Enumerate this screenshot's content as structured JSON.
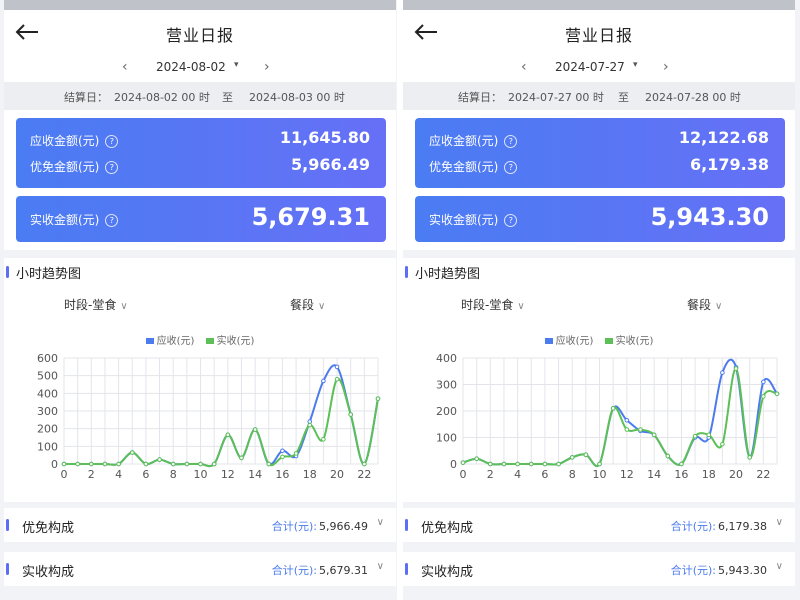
{
  "panels": [
    {
      "title": "营业日报",
      "date": "2024-08-02",
      "settle_label": "结算日：",
      "settle_start": "2024-08-02 00 时",
      "settle_to": "至",
      "settle_end": "2024-08-03 00 时",
      "receivable_label": "应收金额(元)",
      "receivable_value": "11,645.80",
      "discount_label": "优免金额(元)",
      "discount_value": "5,966.49",
      "received_label": "实收金额(元)",
      "received_value": "5,679.31",
      "trend_title": "小时趋势图",
      "filter_period": "时段-堂食",
      "filter_meal": "餐段",
      "discount_section": "优免构成",
      "discount_total_caption": "合计(元):",
      "discount_total_value": "5,966.49",
      "received_section": "实收构成",
      "received_total_caption": "合计(元):",
      "received_total_value": "5,679.31"
    },
    {
      "title": "营业日报",
      "date": "2024-07-27",
      "settle_label": "结算日：",
      "settle_start": "2024-07-27 00 时",
      "settle_to": "至",
      "settle_end": "2024-07-28 00 时",
      "receivable_label": "应收金额(元)",
      "receivable_value": "12,122.68",
      "discount_label": "优免金额(元)",
      "discount_value": "6,179.38",
      "received_label": "实收金额(元)",
      "received_value": "5,943.30",
      "trend_title": "小时趋势图",
      "filter_period": "时段-堂食",
      "filter_meal": "餐段",
      "discount_section": "优免构成",
      "discount_total_caption": "合计(元):",
      "discount_total_value": "6,179.38",
      "received_section": "实收构成",
      "received_total_caption": "合计(元):",
      "received_total_value": "5,943.30"
    }
  ],
  "colors": {
    "receivable": "#4b7bec",
    "received": "#5cbf57",
    "card_start": "#4a7cf3",
    "card_end": "#6670f6"
  },
  "icons": {
    "back": "arrow-left-icon",
    "prev": "chevron-left-icon",
    "next": "chevron-right-icon",
    "help": "question-circle-icon"
  },
  "chart_data": [
    {
      "type": "line",
      "legend": [
        "应收(元)",
        "实收(元)"
      ],
      "x": [
        0,
        1,
        2,
        3,
        4,
        5,
        6,
        7,
        8,
        9,
        10,
        11,
        12,
        13,
        14,
        15,
        16,
        17,
        18,
        19,
        20,
        21,
        22,
        23
      ],
      "xticks": [
        0,
        2,
        4,
        6,
        8,
        10,
        12,
        14,
        16,
        18,
        20,
        22
      ],
      "ylim": [
        0,
        600
      ],
      "yticks": [
        0,
        100,
        200,
        300,
        400,
        500,
        600
      ],
      "grid": true,
      "series": [
        {
          "name": "应收(元)",
          "values": [
            0,
            0,
            0,
            0,
            0,
            65,
            0,
            25,
            0,
            0,
            0,
            0,
            165,
            35,
            195,
            0,
            75,
            45,
            240,
            470,
            550,
            280,
            0,
            370
          ]
        },
        {
          "name": "实收(元)",
          "values": [
            0,
            0,
            0,
            0,
            0,
            65,
            0,
            25,
            0,
            0,
            0,
            0,
            165,
            35,
            195,
            0,
            40,
            60,
            220,
            140,
            480,
            280,
            0,
            370
          ]
        }
      ]
    },
    {
      "type": "line",
      "legend": [
        "应收(元)",
        "实收(元)"
      ],
      "x": [
        0,
        1,
        2,
        3,
        4,
        5,
        6,
        7,
        8,
        9,
        10,
        11,
        12,
        13,
        14,
        15,
        16,
        17,
        18,
        19,
        20,
        21,
        22,
        23
      ],
      "xticks": [
        0,
        2,
        4,
        6,
        8,
        10,
        12,
        14,
        16,
        18,
        20,
        22
      ],
      "ylim": [
        0,
        400
      ],
      "yticks": [
        0,
        100,
        200,
        300,
        400
      ],
      "grid": true,
      "series": [
        {
          "name": "应收(元)",
          "values": [
            5,
            20,
            0,
            0,
            0,
            0,
            0,
            0,
            25,
            35,
            0,
            210,
            165,
            125,
            110,
            30,
            0,
            100,
            100,
            345,
            365,
            25,
            310,
            265
          ]
        },
        {
          "name": "实收(元)",
          "values": [
            5,
            20,
            0,
            0,
            0,
            0,
            0,
            0,
            25,
            35,
            0,
            210,
            130,
            130,
            110,
            30,
            0,
            105,
            110,
            75,
            360,
            25,
            255,
            265
          ]
        }
      ]
    }
  ]
}
